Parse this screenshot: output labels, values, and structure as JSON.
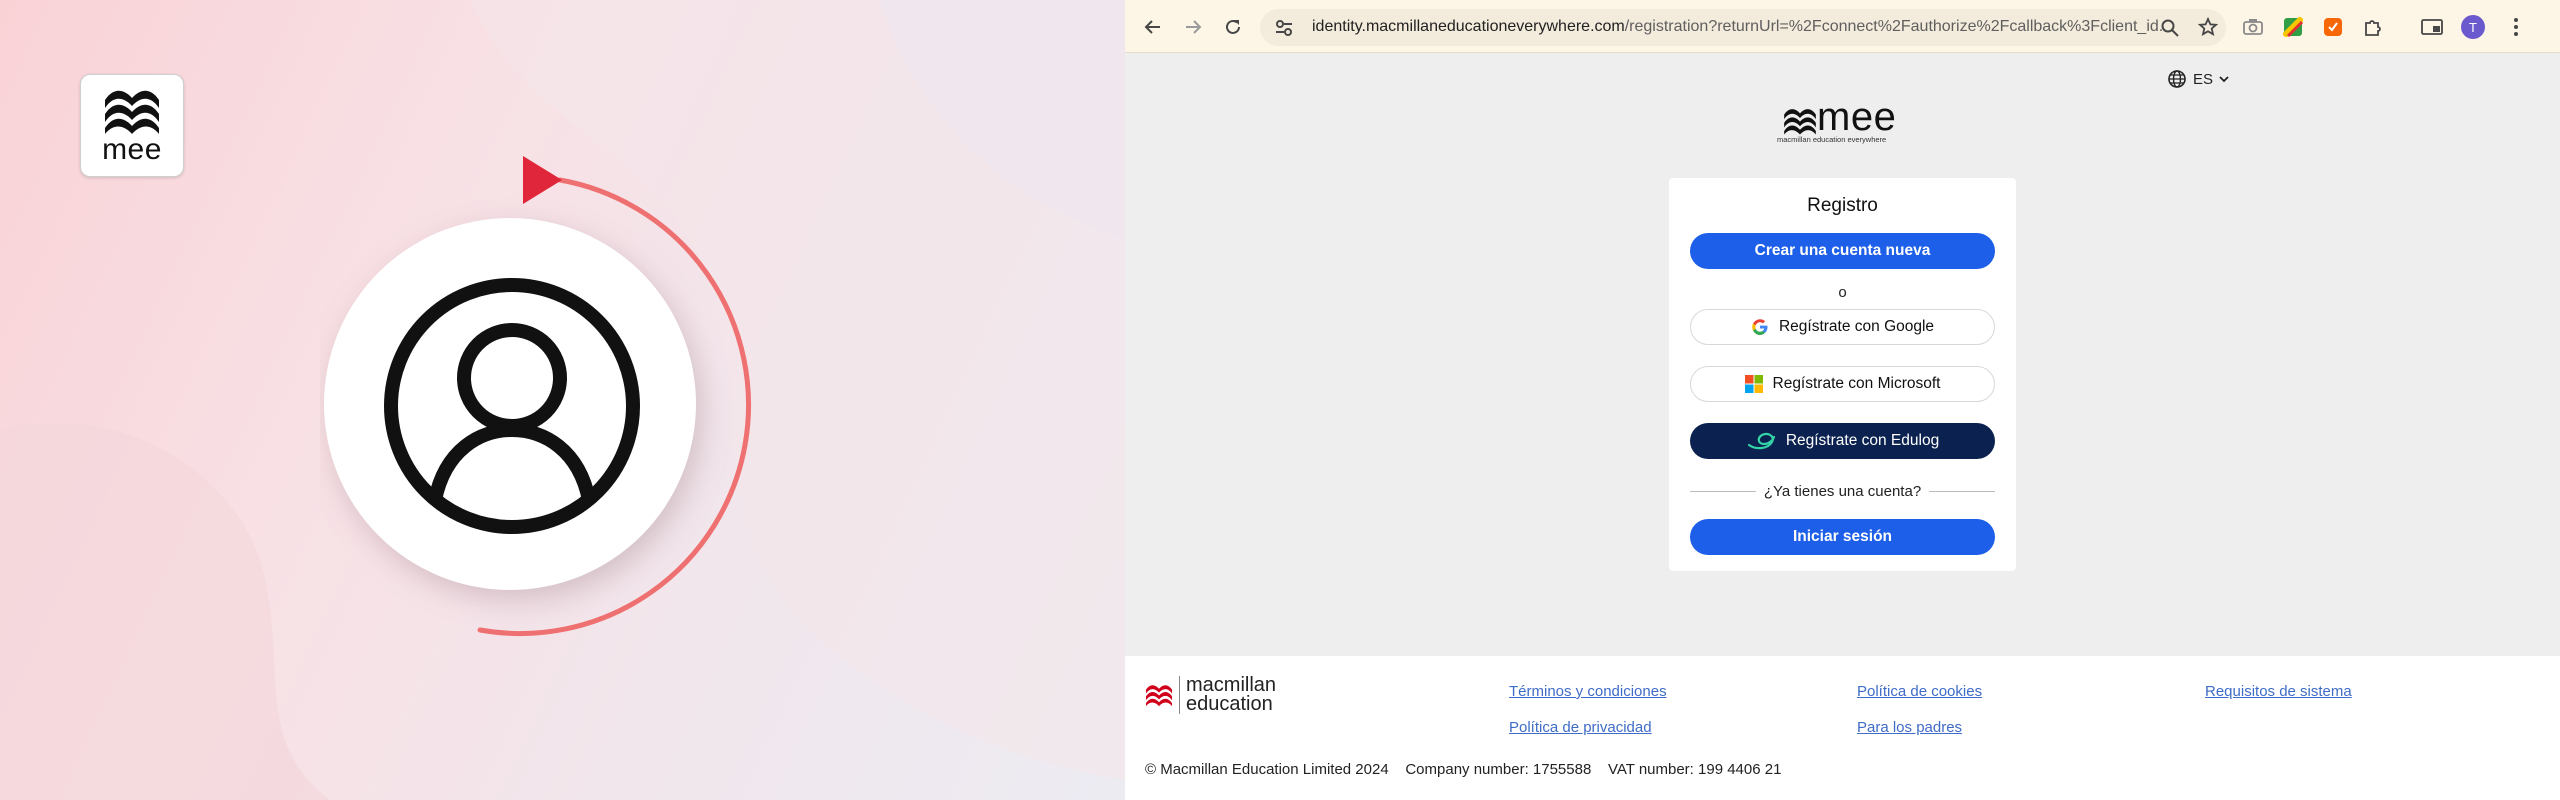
{
  "promo": {
    "logo_text": "mee",
    "colors": {
      "accent_red": "#e0263a",
      "arc": "#ef7070"
    },
    "icons": {
      "logo": "mee-wave-logo",
      "play": "play-icon",
      "user": "user-profile-icon"
    }
  },
  "browser": {
    "url_host": "identity.macmillaneducationeverywhere.com",
    "url_path": "/registration?returnUrl=%2Fconnect%2Fauthorize%2Fcallback%3Fclient_id...",
    "profile_initial": "T",
    "toolbar_icons": [
      "back-icon",
      "forward-icon",
      "reload-icon",
      "site-settings-icon",
      "zoom-icon",
      "bookmark-star-icon",
      "camera-icon",
      "extension-icon",
      "extension-icon",
      "puzzle-icon",
      "reading-mode-icon",
      "profile-avatar",
      "more-menu-icon"
    ]
  },
  "page": {
    "language": "ES",
    "logo_wordmark": "mee",
    "logo_tagline": "macmillan education everywhere",
    "card": {
      "title": "Registro",
      "create_account": "Crear una cuenta nueva",
      "or": "o",
      "google": "Regístrate con Google",
      "microsoft": "Regístrate con Microsoft",
      "edulog": "Regístrate con Edulog",
      "have_account": "¿Ya tienes una cuenta?",
      "sign_in": "Iniciar sesión"
    },
    "colors": {
      "primary": "#1d5fe8",
      "edulog_dark": "#0b2250",
      "link": "#3f6cc6"
    }
  },
  "footer": {
    "logo_line1": "macmillan",
    "logo_line2": "education",
    "links": {
      "terms": "Términos y condiciones",
      "privacy": "Política de privacidad",
      "cookies": "Política de cookies",
      "parents": "Para los padres",
      "requirements": "Requisitos de sistema"
    },
    "copyright": "© Macmillan Education Limited 2024    Company number: 1755588    VAT number: 199 4406 21"
  }
}
